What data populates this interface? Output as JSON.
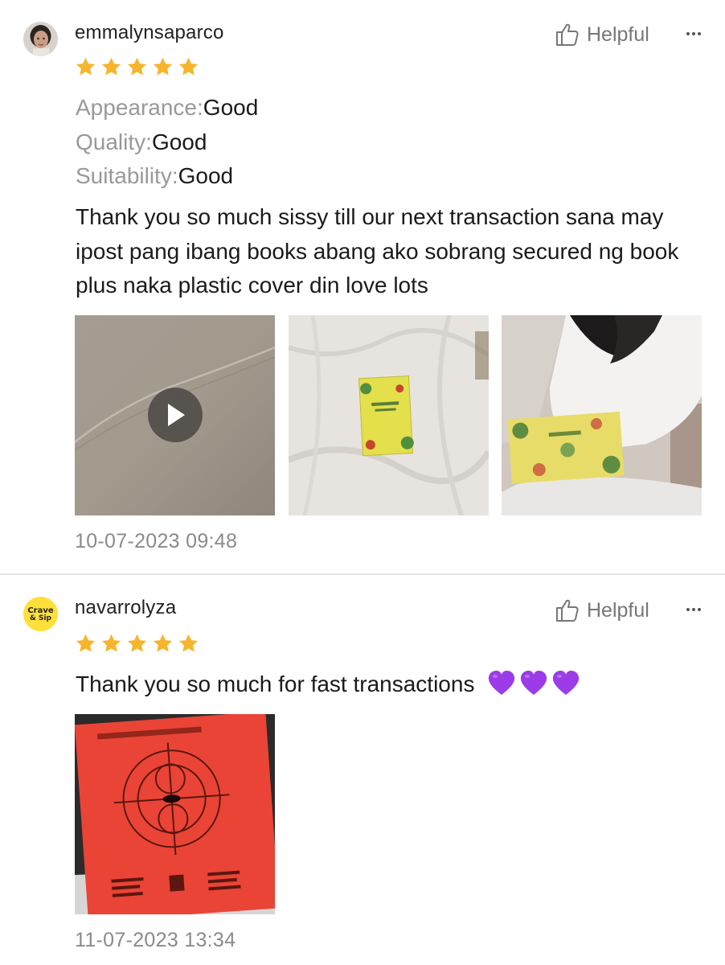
{
  "reviews": [
    {
      "username": "emmalynsaparco",
      "avatar": "user-photo-avatar",
      "rating": 5,
      "helpful_label": "Helpful",
      "attributes": [
        {
          "key": "Appearance:",
          "value": "Good"
        },
        {
          "key": "Quality:",
          "value": "Good"
        },
        {
          "key": "Suitability:",
          "value": "Good"
        }
      ],
      "text": "Thank you so much sissy till our next transaction sana may ipost pang ibang books abang ako sobrang secured ng book plus naka plastic cover din love lots",
      "media": [
        "video-thumbnail",
        "photo-yellow-book-on-sheet",
        "photo-yellow-book-held"
      ],
      "date": "10-07-2023 09:48"
    },
    {
      "username": "navarrolyza",
      "avatar": "crave-and-sip-logo-avatar",
      "avatar_text": "Crave & Sip",
      "rating": 5,
      "helpful_label": "Helpful",
      "text": "Thank you so much for fast transactions",
      "emoji": [
        "purple-heart",
        "purple-heart",
        "purple-heart"
      ],
      "media": [
        "photo-red-map-of-the-soul-card"
      ],
      "date": "11-07-2023 13:34"
    }
  ],
  "colors": {
    "star": "#F7B52C",
    "muted": "#8a8a8a",
    "heart": "#9B3CE8",
    "avatar_logo_bg": "#FFE03A"
  }
}
